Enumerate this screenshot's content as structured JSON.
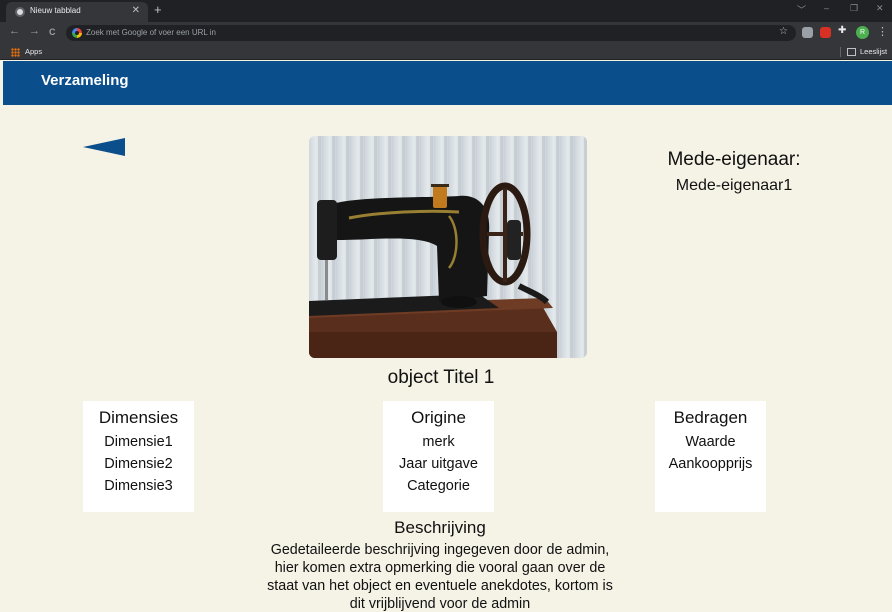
{
  "browser": {
    "tab_title": "Nieuw tabblad",
    "tab_close": "✕",
    "new_tab": "+",
    "window_controls": [
      "﹀",
      "–",
      "❐",
      "✕"
    ],
    "nav_buttons": [
      "←",
      "→",
      "C"
    ],
    "omnibox_placeholder": "Zoek met Google of voer een URL in",
    "profile_initial": "R",
    "menu": "⋮",
    "star": "☆",
    "bookmarks_apps": "Apps",
    "reading_list": "Leeslijst",
    "extension_colors": [
      "#9aa0a6",
      "#d93025",
      "#e8eaed"
    ]
  },
  "app": {
    "title": "Verzameling",
    "accent_color": "#0a4e8c",
    "background_color": "#f5f2e6"
  },
  "object": {
    "back_icon": "back-triangle-icon",
    "photo_subject": "sewing-machine",
    "title": "object Titel 1",
    "coowner_label": "Mede-eigenaar:",
    "coowner_value": "Mede-eigenaar1"
  },
  "cards": [
    {
      "title": "Dimensies",
      "items": [
        "Dimensie1",
        "Dimensie2",
        "Dimensie3"
      ]
    },
    {
      "title": "Origine",
      "items": [
        "merk",
        "Jaar uitgave",
        "Categorie"
      ]
    },
    {
      "title": "Bedragen",
      "items": [
        "Waarde",
        "Aankoopprijs"
      ]
    }
  ],
  "description": {
    "title": "Beschrijving",
    "text": "Gedetaileerde beschrijving ingegeven door de admin, hier komen extra opmerking die vooral gaan over de staat van het object en eventuele anekdotes, kortom is dit vrijblijvend voor de admin"
  }
}
